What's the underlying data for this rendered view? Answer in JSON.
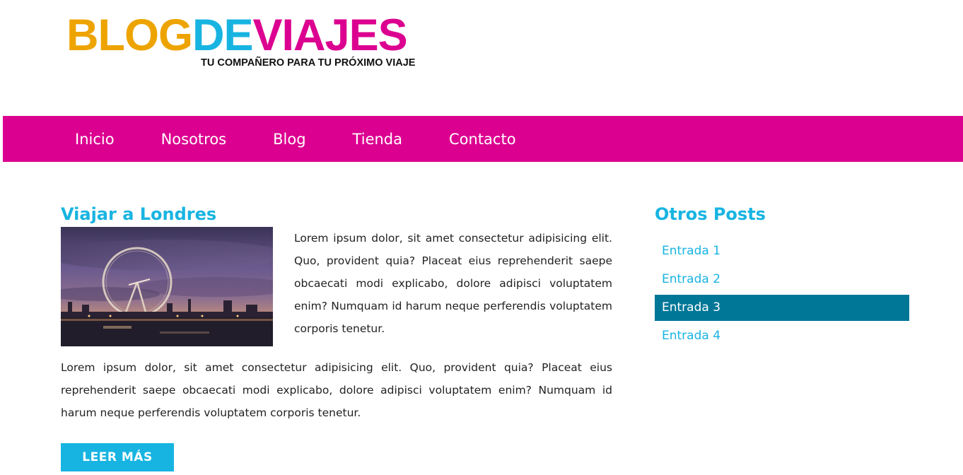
{
  "logo": {
    "part1": "BLOG",
    "part2": "DE",
    "part3": "VIAJES",
    "tagline": "TU COMPAÑERO PARA TU PRÓXIMO VIAJE",
    "colors": {
      "part1": "#eda400",
      "part2": "#18b4e1",
      "part3": "#dc0090"
    }
  },
  "nav": {
    "items": [
      "Inicio",
      "Nosotros",
      "Blog",
      "Tienda",
      "Contacto"
    ],
    "background": "#dc0090"
  },
  "post": {
    "title": "Viajar a Londres",
    "image": "london-eye-sunset-photo",
    "paragraph_1": "Lorem ipsum dolor, sit amet consectetur adipisicing elit. Quo, provident quia? Placeat eius reprehenderit saepe obcaecati modi explicabo, dolore adipisci voluptatem enim? Numquam id harum neque perferendis voluptatem corporis tenetur.",
    "paragraph_2": "Lorem ipsum dolor, sit amet consectetur adipisicing elit. Quo, provident quia? Placeat eius reprehenderit saepe obcaecati modi explicabo, dolore adipisci voluptatem enim? Numquam id harum neque perferendis voluptatem corporis tenetur.",
    "read_more": "LEER MÁS"
  },
  "sidebar": {
    "title": "Otros Posts",
    "items": [
      "Entrada 1",
      "Entrada 2",
      "Entrada 3",
      "Entrada 4"
    ],
    "active": "Entrada 3",
    "accent": "#18b4e1",
    "active_bg": "#007797"
  }
}
